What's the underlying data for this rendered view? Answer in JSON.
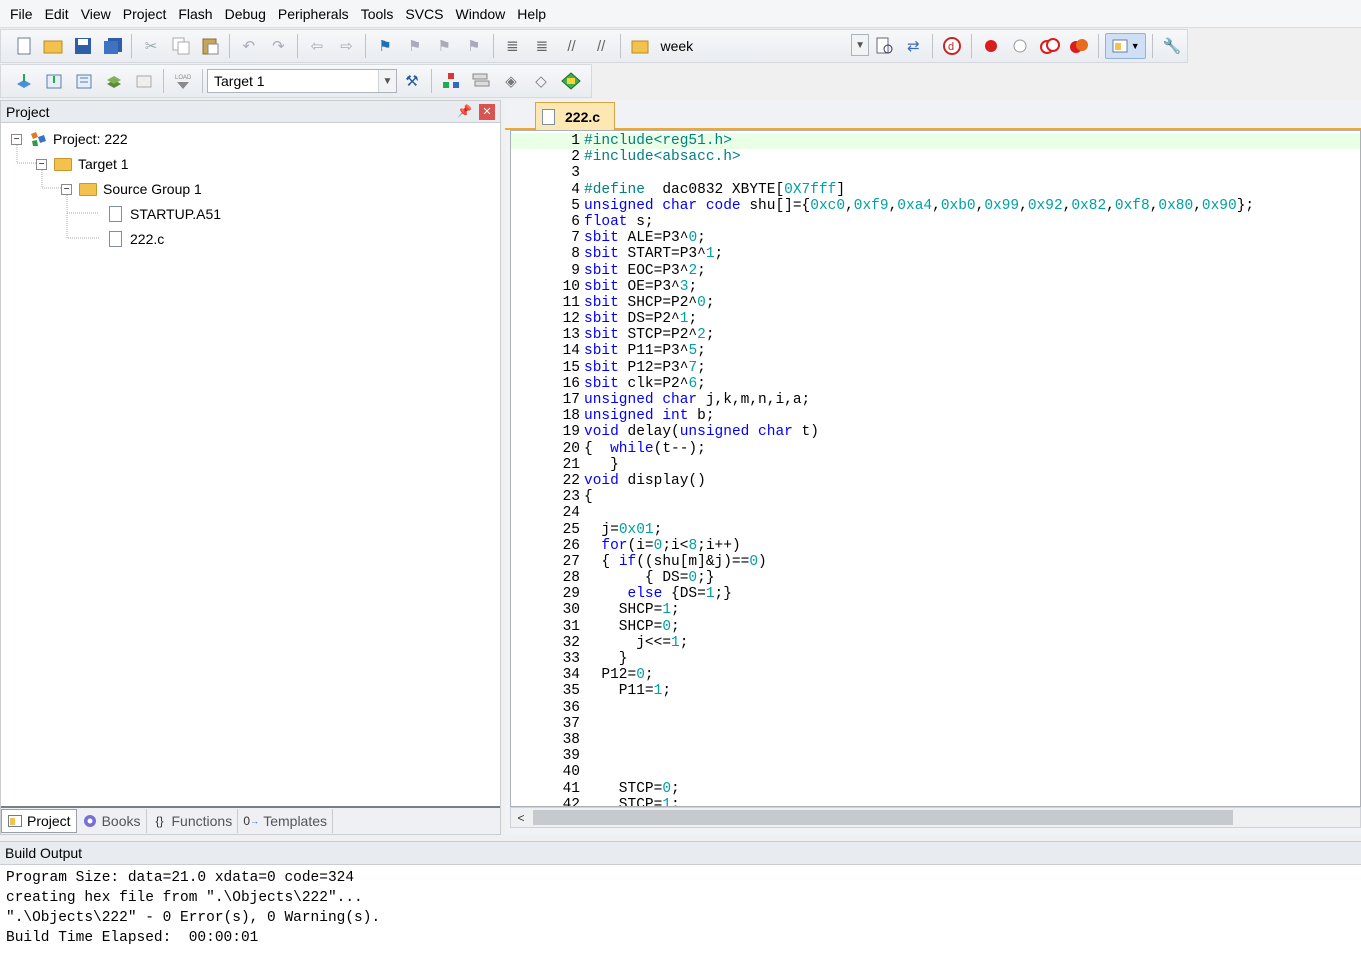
{
  "menu": [
    "File",
    "Edit",
    "View",
    "Project",
    "Flash",
    "Debug",
    "Peripherals",
    "Tools",
    "SVCS",
    "Window",
    "Help"
  ],
  "toolbar": {
    "find_value": "week",
    "target_value": "Target 1"
  },
  "project_panel": {
    "title": "Project",
    "tree": {
      "project": "Project: 222",
      "target": "Target 1",
      "group": "Source Group 1",
      "files": [
        "STARTUP.A51",
        "222.c"
      ]
    },
    "tabs": [
      "Project",
      "Books",
      "Functions",
      "Templates"
    ]
  },
  "editor": {
    "tab": "222.c",
    "lines": [
      {
        "n": "1",
        "segs": [
          [
            "pp",
            "#include<reg51.h>"
          ]
        ]
      },
      {
        "n": "2",
        "segs": [
          [
            "pp",
            "#include<absacc.h>"
          ]
        ]
      },
      {
        "n": "3",
        "segs": []
      },
      {
        "n": "4",
        "segs": [
          [
            "pp",
            "#define"
          ],
          [
            "",
            "  dac0832 XBYTE["
          ],
          [
            "num",
            "0X7fff"
          ],
          [
            "",
            "]"
          ]
        ]
      },
      {
        "n": "5",
        "segs": [
          [
            "kw",
            "unsigned char code"
          ],
          [
            "",
            " shu[]={"
          ],
          [
            "num",
            "0xc0"
          ],
          [
            "",
            ","
          ],
          [
            "num",
            "0xf9"
          ],
          [
            "",
            ","
          ],
          [
            "num",
            "0xa4"
          ],
          [
            "",
            ","
          ],
          [
            "num",
            "0xb0"
          ],
          [
            "",
            ","
          ],
          [
            "num",
            "0x99"
          ],
          [
            "",
            ","
          ],
          [
            "num",
            "0x92"
          ],
          [
            "",
            ","
          ],
          [
            "num",
            "0x82"
          ],
          [
            "",
            ","
          ],
          [
            "num",
            "0xf8"
          ],
          [
            "",
            ","
          ],
          [
            "num",
            "0x80"
          ],
          [
            "",
            ","
          ],
          [
            "num",
            "0x90"
          ],
          [
            "",
            "};"
          ]
        ]
      },
      {
        "n": "6",
        "segs": [
          [
            "kw",
            "float"
          ],
          [
            "",
            " s;"
          ]
        ]
      },
      {
        "n": "7",
        "segs": [
          [
            "kw",
            "sbit"
          ],
          [
            "",
            " ALE=P3^"
          ],
          [
            "num",
            "0"
          ],
          [
            "",
            ";"
          ]
        ]
      },
      {
        "n": "8",
        "segs": [
          [
            "kw",
            "sbit"
          ],
          [
            "",
            " START=P3^"
          ],
          [
            "num",
            "1"
          ],
          [
            "",
            ";"
          ]
        ]
      },
      {
        "n": "9",
        "segs": [
          [
            "kw",
            "sbit"
          ],
          [
            "",
            " EOC=P3^"
          ],
          [
            "num",
            "2"
          ],
          [
            "",
            ";"
          ]
        ]
      },
      {
        "n": "10",
        "segs": [
          [
            "kw",
            "sbit"
          ],
          [
            "",
            " OE=P3^"
          ],
          [
            "num",
            "3"
          ],
          [
            "",
            ";"
          ]
        ]
      },
      {
        "n": "11",
        "segs": [
          [
            "kw",
            "sbit"
          ],
          [
            "",
            " SHCP=P2^"
          ],
          [
            "num",
            "0"
          ],
          [
            "",
            ";"
          ]
        ]
      },
      {
        "n": "12",
        "segs": [
          [
            "kw",
            "sbit"
          ],
          [
            "",
            " DS=P2^"
          ],
          [
            "num",
            "1"
          ],
          [
            "",
            ";"
          ]
        ]
      },
      {
        "n": "13",
        "segs": [
          [
            "kw",
            "sbit"
          ],
          [
            "",
            " STCP=P2^"
          ],
          [
            "num",
            "2"
          ],
          [
            "",
            ";"
          ]
        ]
      },
      {
        "n": "14",
        "segs": [
          [
            "kw",
            "sbit"
          ],
          [
            "",
            " P11=P3^"
          ],
          [
            "num",
            "5"
          ],
          [
            "",
            ";"
          ]
        ]
      },
      {
        "n": "15",
        "segs": [
          [
            "kw",
            "sbit"
          ],
          [
            "",
            " P12=P3^"
          ],
          [
            "num",
            "7"
          ],
          [
            "",
            ";"
          ]
        ]
      },
      {
        "n": "16",
        "segs": [
          [
            "kw",
            "sbit"
          ],
          [
            "",
            " clk=P2^"
          ],
          [
            "num",
            "6"
          ],
          [
            "",
            ";"
          ]
        ]
      },
      {
        "n": "17",
        "segs": [
          [
            "kw",
            "unsigned char"
          ],
          [
            "",
            " j,k,m,n,i,a;"
          ]
        ]
      },
      {
        "n": "18",
        "segs": [
          [
            "kw",
            "unsigned int"
          ],
          [
            "",
            " b;"
          ]
        ]
      },
      {
        "n": "19",
        "segs": [
          [
            "kw",
            "void"
          ],
          [
            "",
            " delay("
          ],
          [
            "kw",
            "unsigned char"
          ],
          [
            "",
            " t)"
          ]
        ]
      },
      {
        "n": "20",
        "segs": [
          [
            "",
            "{  "
          ],
          [
            "kw",
            "while"
          ],
          [
            "",
            "(t--);"
          ]
        ]
      },
      {
        "n": "21",
        "segs": [
          [
            "",
            "   }"
          ]
        ]
      },
      {
        "n": "22",
        "segs": [
          [
            "kw",
            "void"
          ],
          [
            "",
            " display()"
          ]
        ]
      },
      {
        "n": "23",
        "segs": [
          [
            "",
            "{"
          ]
        ]
      },
      {
        "n": "24",
        "segs": []
      },
      {
        "n": "25",
        "segs": [
          [
            "",
            "  j="
          ],
          [
            "num",
            "0x01"
          ],
          [
            "",
            ";"
          ]
        ]
      },
      {
        "n": "26",
        "segs": [
          [
            "",
            "  "
          ],
          [
            "kw",
            "for"
          ],
          [
            "",
            "(i="
          ],
          [
            "num",
            "0"
          ],
          [
            "",
            ";i<"
          ],
          [
            "num",
            "8"
          ],
          [
            "",
            ";i++)"
          ]
        ]
      },
      {
        "n": "27",
        "segs": [
          [
            "",
            "  { "
          ],
          [
            "kw",
            "if"
          ],
          [
            "",
            "((shu[m]&j)=="
          ],
          [
            "num",
            "0"
          ],
          [
            "",
            ")"
          ]
        ]
      },
      {
        "n": "28",
        "segs": [
          [
            "",
            "       { DS="
          ],
          [
            "num",
            "0"
          ],
          [
            "",
            ";}"
          ]
        ]
      },
      {
        "n": "29",
        "segs": [
          [
            "",
            "     "
          ],
          [
            "kw",
            "else"
          ],
          [
            "",
            " {DS="
          ],
          [
            "num",
            "1"
          ],
          [
            "",
            ";}"
          ]
        ]
      },
      {
        "n": "30",
        "segs": [
          [
            "",
            "    SHCP="
          ],
          [
            "num",
            "1"
          ],
          [
            "",
            ";"
          ]
        ]
      },
      {
        "n": "31",
        "segs": [
          [
            "",
            "    SHCP="
          ],
          [
            "num",
            "0"
          ],
          [
            "",
            ";"
          ]
        ]
      },
      {
        "n": "32",
        "segs": [
          [
            "",
            "      j<<="
          ],
          [
            "num",
            "1"
          ],
          [
            "",
            ";"
          ]
        ]
      },
      {
        "n": "33",
        "segs": [
          [
            "",
            "    }"
          ]
        ]
      },
      {
        "n": "34",
        "segs": [
          [
            "",
            "  P12="
          ],
          [
            "num",
            "0"
          ],
          [
            "",
            ";"
          ]
        ]
      },
      {
        "n": "35",
        "segs": [
          [
            "",
            "    P11="
          ],
          [
            "num",
            "1"
          ],
          [
            "",
            ";"
          ]
        ]
      },
      {
        "n": "36",
        "segs": []
      },
      {
        "n": "37",
        "segs": []
      },
      {
        "n": "38",
        "segs": []
      },
      {
        "n": "39",
        "segs": []
      },
      {
        "n": "40",
        "segs": []
      },
      {
        "n": "41",
        "segs": [
          [
            "",
            "    STCP="
          ],
          [
            "num",
            "0"
          ],
          [
            "",
            ";"
          ]
        ]
      },
      {
        "n": "42",
        "segs": [
          [
            "",
            "    STCP="
          ],
          [
            "num",
            "1"
          ],
          [
            "",
            ";"
          ]
        ]
      }
    ]
  },
  "build_output": {
    "title": "Build Output",
    "lines": [
      "Program Size: data=21.0 xdata=0 code=324",
      "creating hex file from \".\\Objects\\222\"...",
      "\".\\Objects\\222\" - 0 Error(s), 0 Warning(s).",
      "Build Time Elapsed:  00:00:01"
    ]
  },
  "colors": {
    "keyword": "#0000ff",
    "preprocessor": "#008080",
    "number": "#00a0a0",
    "active_tab": "#fde8b3",
    "current_line": "#e9ffe6"
  }
}
